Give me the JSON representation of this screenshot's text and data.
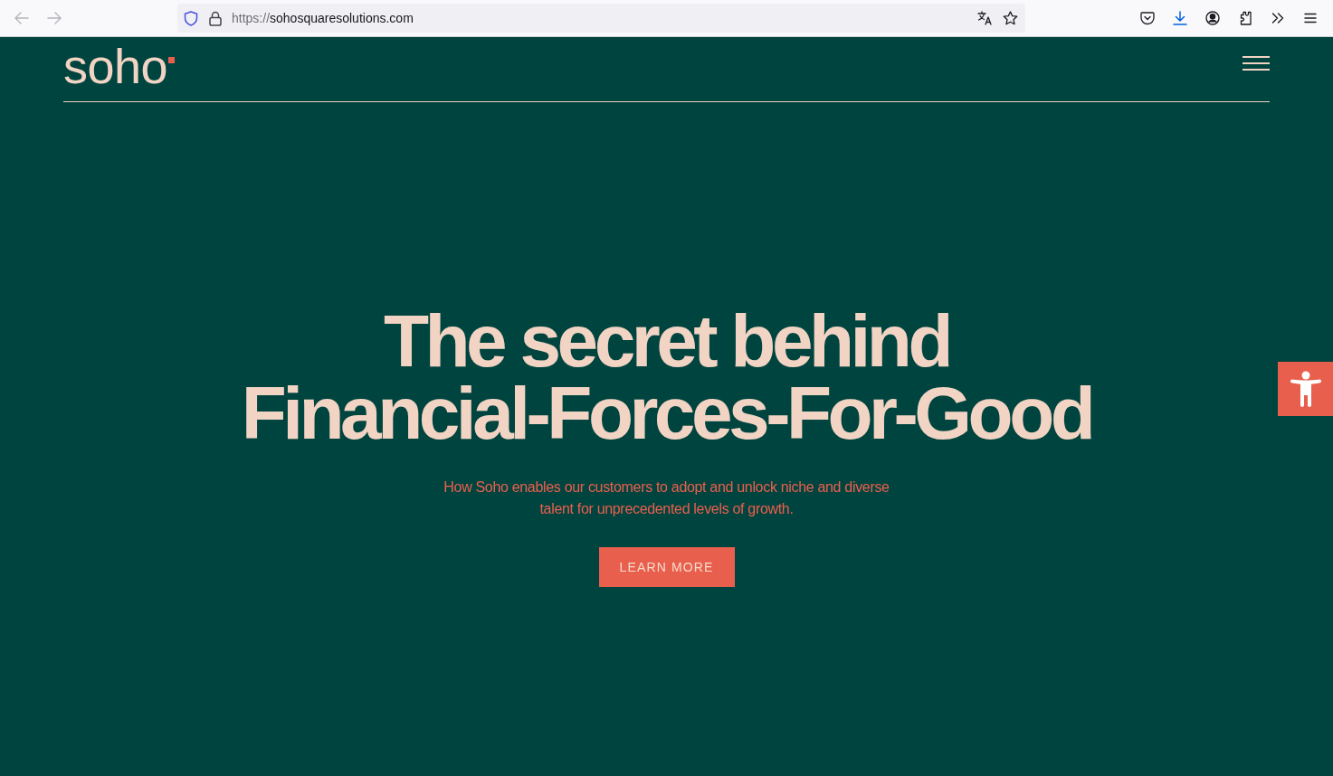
{
  "browser": {
    "nav_buttons": [
      {
        "kind": "back",
        "disabled": true
      },
      {
        "kind": "forward",
        "disabled": true
      }
    ],
    "url": {
      "scheme": "https://",
      "host": "sohosquaresolutions.com"
    }
  },
  "site": {
    "logo": "soho",
    "hero": {
      "title_lines": [
        "The secret behind",
        "Financial-Forces-For-Good"
      ],
      "subtitle": "How Soho enables our customers to adopt and unlock niche and diverse talent for unprecedented levels of growth.",
      "button": "LEARN MORE"
    }
  }
}
